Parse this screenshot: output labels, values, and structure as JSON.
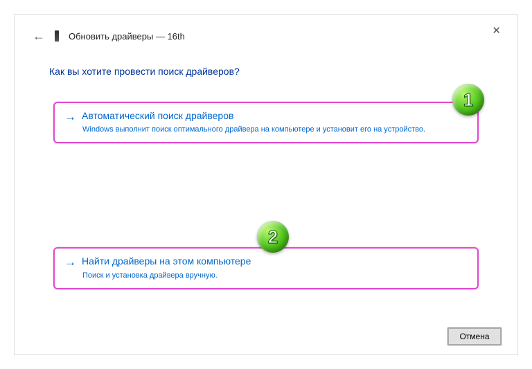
{
  "window": {
    "title": "Обновить драйверы — 16th"
  },
  "question": "Как вы хотите провести поиск драйверов?",
  "option1": {
    "title": "Автоматический поиск драйверов",
    "desc": "Windows выполнит поиск оптимального драйвера на компьютере и установит его на устройство.",
    "badge": "1"
  },
  "option2": {
    "title": "Найти драйверы на этом компьютере",
    "desc": "Поиск и установка драйвера вручную.",
    "badge": "2"
  },
  "footer": {
    "cancel": "Отмена"
  }
}
